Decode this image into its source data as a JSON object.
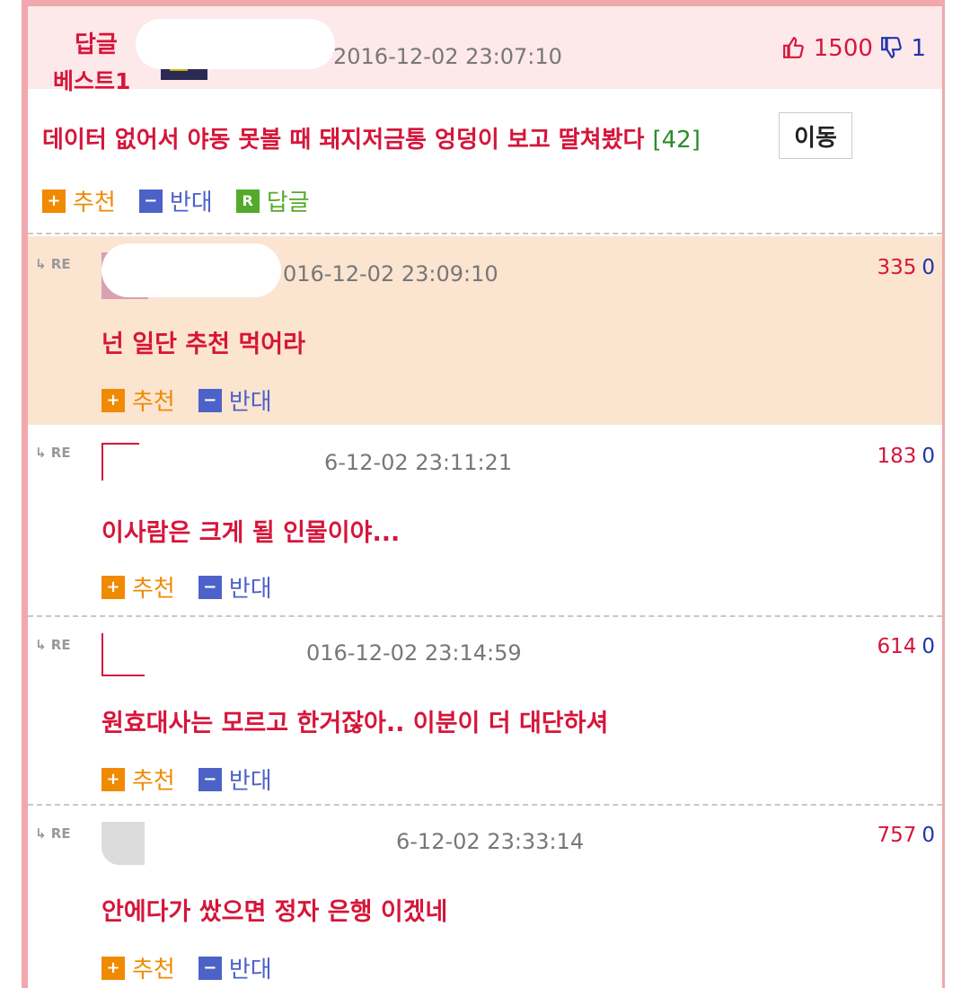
{
  "post": {
    "best_line1": "답글",
    "best_line2": "베스트1",
    "date": "2016-12-02 23:07:10",
    "up_count": "1500",
    "down_count": "1",
    "title": "데이터 없어서 야동 못볼 때 돼지저금통 엉덩이 보고 딸쳐봤다",
    "comment_count": "[42]",
    "move_button": "이동",
    "recommend": "추천",
    "oppose": "반대",
    "reply": "답글"
  },
  "icons": {
    "plus": "+",
    "minus": "−",
    "reply_r": "R",
    "thumb_up_icon": "thumb-up-icon",
    "thumb_down_icon": "thumb-down-icon"
  },
  "re_tag": "RE",
  "comments": [
    {
      "date": "016-12-02 23:09:10",
      "up": "335",
      "down": "0",
      "text": "넌 일단 추천 먹어라",
      "recommend": "추천",
      "oppose": "반대"
    },
    {
      "date": "6-12-02 23:11:21",
      "up": "183",
      "down": "0",
      "text": "이사람은 크게 될 인물이야...",
      "recommend": "추천",
      "oppose": "반대"
    },
    {
      "date": "016-12-02 23:14:59",
      "up": "614",
      "down": "0",
      "text": "원효대사는 모르고 한거잖아.. 이분이 더 대단하셔",
      "recommend": "추천",
      "oppose": "반대"
    },
    {
      "date": "6-12-02 23:33:14",
      "up": "757",
      "down": "0",
      "text": "안에다가 쌌으면 정자 은행 이겠네",
      "recommend": "추천",
      "oppose": "반대"
    }
  ],
  "colors": {
    "accent_red": "#d6153a",
    "highlight_bg": "#fbe4d0",
    "header_bg": "#fde8ea",
    "plus_orange": "#f08a00",
    "minus_blue": "#4d62c8",
    "reply_green": "#55aa2a"
  }
}
